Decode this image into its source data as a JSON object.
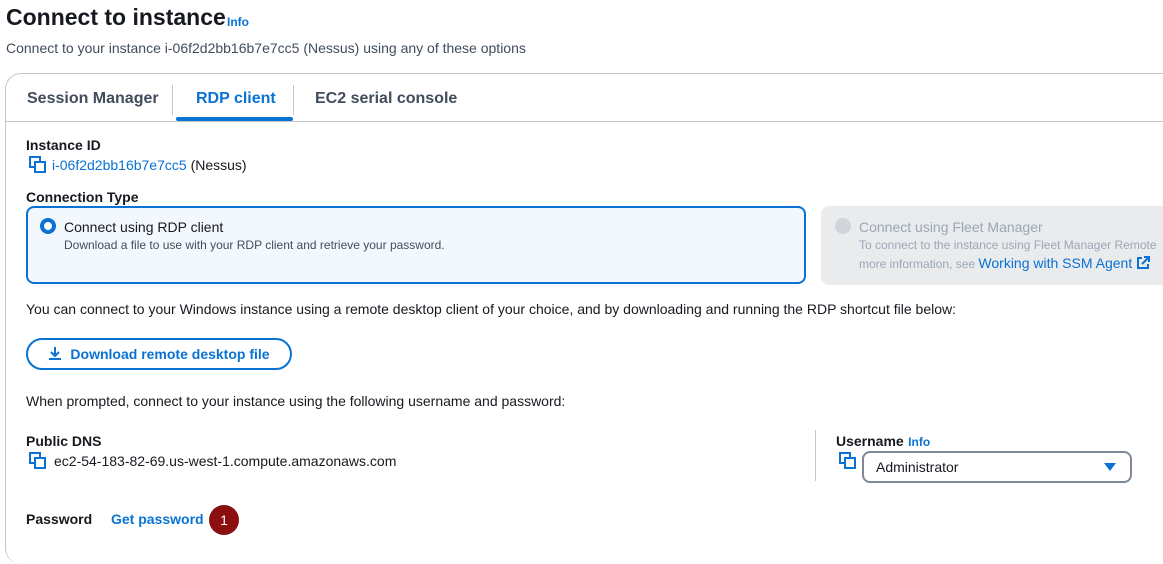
{
  "header": {
    "title": "Connect to instance",
    "info": "Info",
    "subtitle": "Connect to your instance i-06f2d2bb16b7e7cc5 (Nessus) using any of these options"
  },
  "tabs": [
    {
      "label": "Session Manager",
      "active": false
    },
    {
      "label": "RDP client",
      "active": true
    },
    {
      "label": "EC2 serial console",
      "active": false
    }
  ],
  "instance": {
    "label": "Instance ID",
    "id": "i-06f2d2bb16b7e7cc5",
    "name": "(Nessus)"
  },
  "connection_type": {
    "label": "Connection Type",
    "rdp": {
      "title": "Connect using RDP client",
      "description": "Download a file to use with your RDP client and retrieve your password.",
      "selected": true
    },
    "fleet": {
      "title": "Connect using Fleet Manager",
      "description_line1": "To connect to the instance using Fleet Manager Remote",
      "description_line2_prefix": "more information, see",
      "link": "Working with SSM Agent",
      "disabled": true
    }
  },
  "intro_text": "You can connect to your Windows instance using a remote desktop client of your choice, and by downloading and running the RDP shortcut file below:",
  "download_button": "Download remote desktop file",
  "prompt_text": "When prompted, connect to your instance using the following username and password:",
  "public_dns": {
    "label": "Public DNS",
    "value": "ec2-54-183-82-69.us-west-1.compute.amazonaws.com"
  },
  "username": {
    "label": "Username",
    "info": "Info",
    "value": "Administrator"
  },
  "password": {
    "label": "Password",
    "link": "Get password"
  },
  "annotation": {
    "step": "1"
  },
  "colors": {
    "accent": "#0972d3",
    "annotation": "#8b0f0f",
    "selected_card_bg": "#f2f8fd",
    "disabled_card_bg": "#e9ebed"
  }
}
